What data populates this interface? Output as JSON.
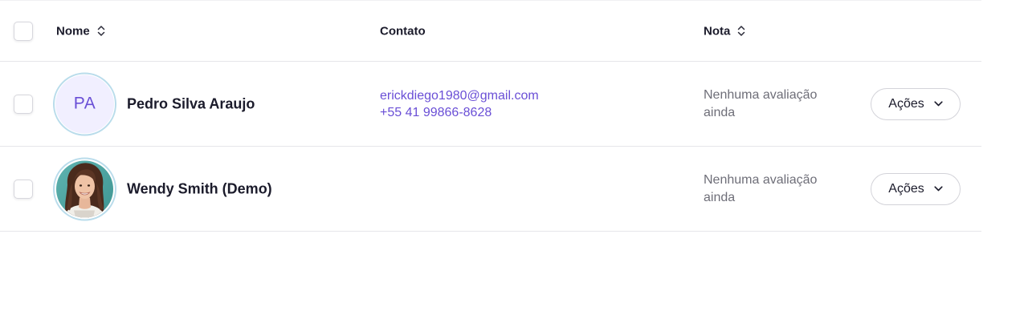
{
  "table": {
    "headers": {
      "name": "Nome",
      "contact": "Contato",
      "rating": "Nota"
    },
    "rows": [
      {
        "avatar_initials": "PA",
        "name": "Pedro Silva Araujo",
        "email": "erickdiego1980@gmail.com",
        "phone": "+55 41 99866-8628",
        "rating": "Nenhuma avaliação ainda",
        "actions_label": "Ações"
      },
      {
        "avatar_initials": "",
        "avatar_image": "portrait-photo",
        "name": "Wendy Smith (Demo)",
        "email": "",
        "phone": "",
        "rating": "Nenhuma avaliação ainda",
        "actions_label": "Ações"
      }
    ]
  },
  "colors": {
    "accent": "#6a4fd6",
    "avatar_bg": "#f1efff",
    "avatar_ring": "#b9dceb",
    "muted_text": "#6e6e78",
    "divider": "#e6e6ea"
  },
  "icons": {
    "sort": "sort-updown-icon",
    "dropdown": "chevron-down-icon"
  }
}
